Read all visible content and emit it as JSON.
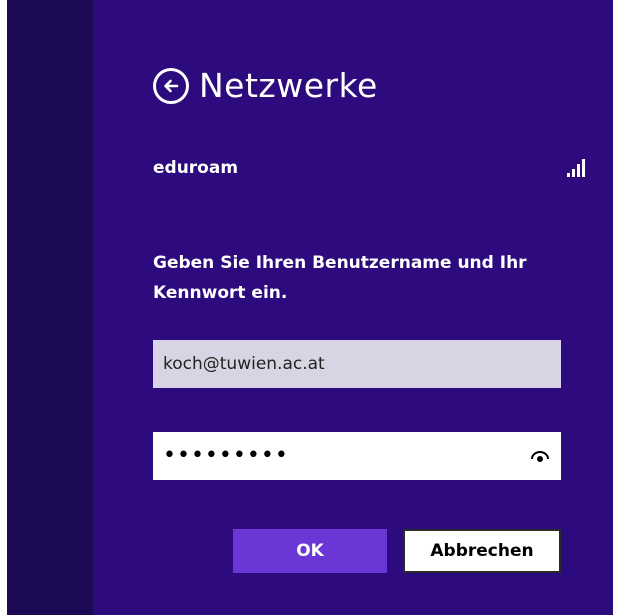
{
  "header": {
    "title": "Netzwerke"
  },
  "network": {
    "name": "eduroam",
    "signal_bars": 4
  },
  "login": {
    "prompt": "Geben Sie Ihren Benutzername und Ihr Kennwort ein.",
    "username_value": "koch@tuwien.ac.at",
    "password_mask": "•••••••••"
  },
  "buttons": {
    "ok_label": "OK",
    "cancel_label": "Abbrechen"
  },
  "colors": {
    "background": "#2d0a7d",
    "left_strip": "#1c0a55",
    "ok_button": "#6a36d6",
    "username_field": "#d9d4e3"
  },
  "icons": {
    "back": "back-arrow-circle-icon",
    "signal": "wifi-signal-bars-icon",
    "reveal": "eye-icon"
  }
}
